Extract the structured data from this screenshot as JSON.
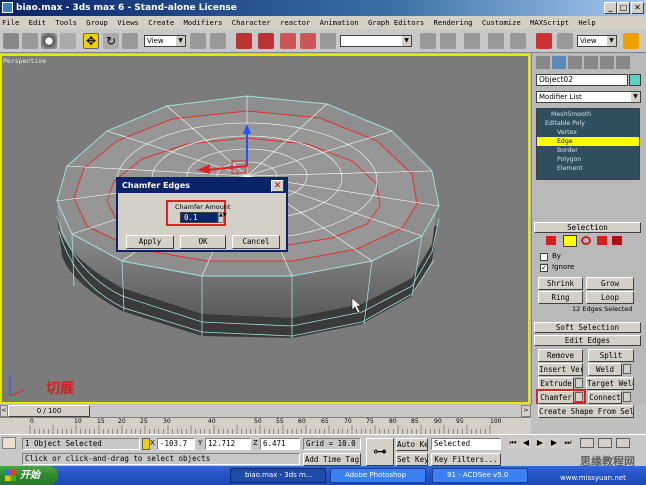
{
  "window": {
    "title": "biao.max - 3ds max 6 - Stand-alone License"
  },
  "menu": [
    "File",
    "Edit",
    "Tools",
    "Group",
    "Views",
    "Create",
    "Modifiers",
    "Character",
    "reactor",
    "Animation",
    "Graph Editors",
    "Rendering",
    "Customize",
    "MAXScript",
    "Help"
  ],
  "toolbar": {
    "view_dropdown": "View",
    "view_dropdown2": "View"
  },
  "viewport": {
    "label": "Perspective",
    "annotation": "切展"
  },
  "dialog": {
    "title": "Chamfer Edges",
    "field_label": "Chamfer Amount",
    "field_value": "0.1",
    "apply": "Apply",
    "ok": "OK",
    "cancel": "Cancel"
  },
  "command_panel": {
    "object_name": "Object02",
    "modifier_list": "Modifier List",
    "stack": [
      "MeshSmooth",
      "Editable Poly",
      "Vertex",
      "Edge",
      "Border",
      "Polygon",
      "Element"
    ],
    "selection": {
      "title": "Selection",
      "by": "By",
      "ignore": "Ignore",
      "shrink": "Shrink",
      "grow": "Grow",
      "ring": "Ring",
      "loop": "Loop",
      "info": "12 Edges Selected"
    },
    "soft_selection": "Soft Selection",
    "edit_edges": {
      "title": "Edit Edges",
      "remove": "Remove",
      "split": "Split",
      "insert_vertex": "Insert Vertex",
      "weld": "Weld",
      "extrude": "Extrude",
      "target_weld": "Target Weld",
      "chamfer": "Chamfer",
      "connect": "Connect",
      "create_shape": "Create Shape From Selection"
    }
  },
  "timeline": {
    "frame": "0 / 100",
    "ticks": [
      "0",
      "10",
      "15",
      "20",
      "25",
      "30",
      "40",
      "50",
      "55",
      "60",
      "65",
      "70",
      "75",
      "80",
      "85",
      "90",
      "95",
      "100"
    ]
  },
  "status": {
    "selected": "1 Object Selected",
    "prompt": "Click or click-and-drag to select objects",
    "x": "-103.7",
    "y": "12.712",
    "z": "6.471",
    "grid": "Grid = 10.0",
    "add_time_tag": "Add Time Tag",
    "auto_key": "Auto Key",
    "set_key": "Set Key",
    "selected_dd": "Selected",
    "key_filters": "Key Filters..."
  },
  "taskbar": {
    "start": "开始",
    "tasks": [
      "biao.max - 3ds m...",
      "Adobe Photoshop",
      "91 - ACDSee v5.0"
    ],
    "watermark": "思缘教程网",
    "url": "www.missyuan.net"
  }
}
